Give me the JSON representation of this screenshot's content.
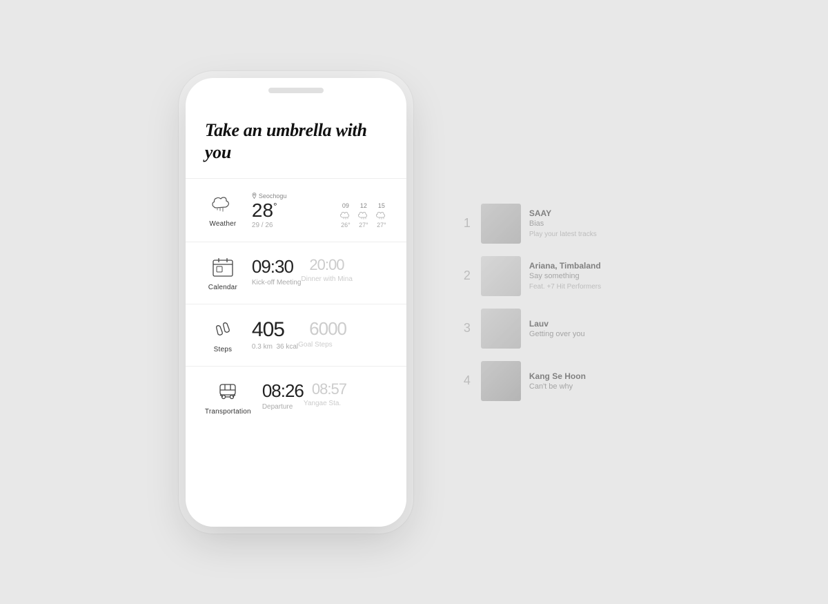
{
  "phone": {
    "title": "Take an umbrella with you",
    "widgets": {
      "weather": {
        "label": "Weather",
        "location": "Seochogu",
        "temp": "28",
        "temp_unit": "°",
        "range": "29 / 26",
        "forecast": [
          {
            "time": "09",
            "temp": "26°",
            "icon": "cloud"
          },
          {
            "time": "12",
            "temp": "27°",
            "icon": "cloud"
          },
          {
            "time": "15",
            "temp": "27°",
            "icon": "cloud"
          }
        ]
      },
      "calendar": {
        "label": "Calendar",
        "primary_time": "09:30",
        "primary_event": "Kick-off Meeting",
        "secondary_time": "20:00",
        "secondary_event": "Dinner with Mina"
      },
      "steps": {
        "label": "Steps",
        "count": "405",
        "distance": "0.3 km",
        "kcal": "36 kcal",
        "goal": "6000",
        "goal_label": "Goal Steps"
      },
      "transportation": {
        "label": "Transportation",
        "departure_time": "08:26",
        "departure_label": "Departure",
        "arrival_time": "08:57",
        "arrival_station": "Yangae Sta."
      }
    }
  },
  "music_list": [
    {
      "number": "1",
      "artist": "SAAY",
      "title": "Bias",
      "sub": "Play your latest tracks"
    },
    {
      "number": "2",
      "artist": "Ariana, Timbaland",
      "title": "Say something",
      "sub": "Feat. +7 Hit Performers"
    },
    {
      "number": "3",
      "artist": "Lauv",
      "title": "Getting over you",
      "sub": ""
    },
    {
      "number": "4",
      "artist": "Kang Se Hoon",
      "title": "Can't be why",
      "sub": ""
    }
  ]
}
